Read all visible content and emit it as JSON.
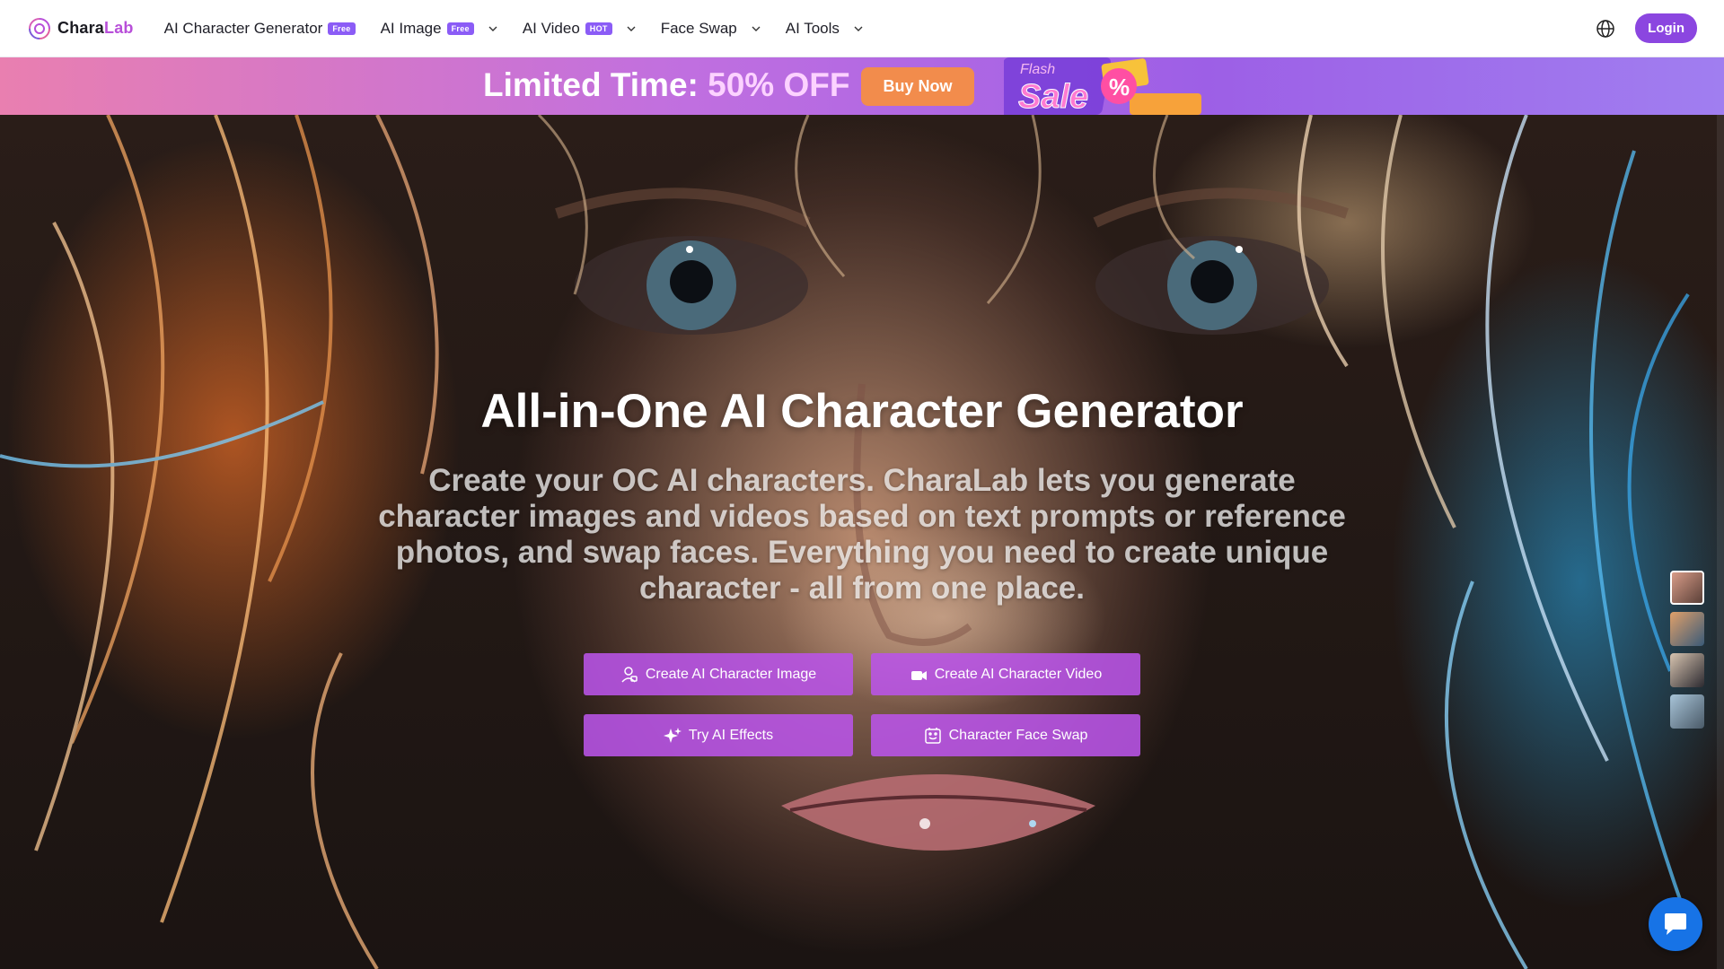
{
  "brand": {
    "name_part1": "Chara",
    "name_part2": "Lab"
  },
  "nav": {
    "items": [
      {
        "label": "AI Character Generator",
        "badge": "Free",
        "dropdown": false
      },
      {
        "label": "AI Image",
        "badge": "Free",
        "dropdown": true
      },
      {
        "label": "AI Video",
        "badge": "HOT",
        "dropdown": true
      },
      {
        "label": "Face Swap",
        "badge": "",
        "dropdown": true
      },
      {
        "label": "AI Tools",
        "badge": "",
        "dropdown": true
      }
    ],
    "login_label": "Login"
  },
  "promo": {
    "text_part1": "Limited Time: ",
    "text_part2": "50% OFF",
    "buy_label": "Buy Now",
    "sale_top": "Flash",
    "sale_word": "Sale",
    "sale_pct": "%"
  },
  "hero": {
    "title": "All-in-One AI Character Generator",
    "description": "Create your OC AI characters. CharaLab lets you generate character images and videos based on text prompts or reference photos, and swap faces. Everything you need to create unique character - all from one place.",
    "buttons": {
      "create_image": "Create AI Character Image",
      "create_video": "Create AI Character Video",
      "ai_effects": "Try AI Effects",
      "face_swap": "Character Face Swap"
    }
  },
  "colors": {
    "brand_purple": "#8b46e0",
    "cta_purple": "#ba54e8",
    "buy_orange": "#f28c4c",
    "chat_blue": "#1773e6"
  },
  "icons": {
    "chat": "chat-bubble-icon",
    "globe": "globe-icon"
  }
}
